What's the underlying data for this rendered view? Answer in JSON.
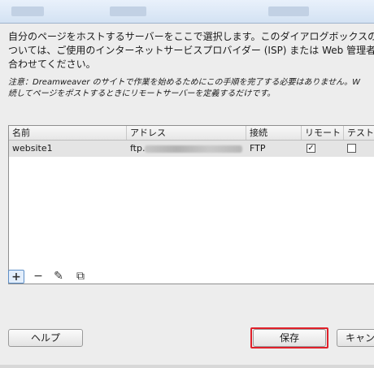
{
  "intro": {
    "lines": [
      "自分のページをホストするサーバーをここで選択します。このダイアログボックスの設",
      "ついては、ご使用のインターネットサービスプロバイダー (ISP) または Web 管理者",
      "合わせてください。"
    ]
  },
  "note": {
    "lines": [
      "注意：Dreamweaver のサイトで作業を始めるためにこの手順を完了する必要はありません。W",
      "続してページをポストするときにリモートサーバーを定義するだけです。"
    ]
  },
  "table": {
    "headers": [
      "名前",
      "アドレス",
      "接続",
      "リモート",
      "テスト"
    ],
    "rows": [
      {
        "name": "website1",
        "address_prefix": "ftp.",
        "connection": "FTP",
        "remote": true,
        "test": false
      }
    ]
  },
  "toolbar": {
    "add_label": "+",
    "remove_label": "−",
    "edit_label": "✎",
    "duplicate_label": "⧉"
  },
  "buttons": {
    "help": "ヘルプ",
    "save": "保存",
    "cancel": "キャン"
  },
  "colors": {
    "highlight": "#e0202a",
    "active_button_border": "#5e8fc7"
  }
}
